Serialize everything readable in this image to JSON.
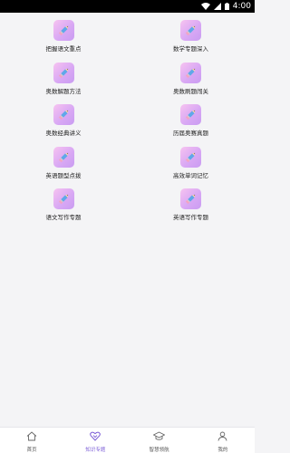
{
  "status_bar": {
    "time": "4:00"
  },
  "topics": [
    {
      "label": "把握语文重点",
      "icon": "pencil-icon"
    },
    {
      "label": "数学专题深入",
      "icon": "pencil-icon"
    },
    {
      "label": "奥数解题方法",
      "icon": "pencil-icon"
    },
    {
      "label": "奥数刷题闯关",
      "icon": "pencil-icon"
    },
    {
      "label": "奥数经典讲义",
      "icon": "pencil-icon"
    },
    {
      "label": "历届奥赛真题",
      "icon": "pencil-icon"
    },
    {
      "label": "英语题型点拨",
      "icon": "pencil-icon"
    },
    {
      "label": "高效单词记忆",
      "icon": "pencil-icon"
    },
    {
      "label": "语文写作专题",
      "icon": "pencil-icon"
    },
    {
      "label": "英语写作专题",
      "icon": "pencil-icon"
    }
  ],
  "bottom_nav": {
    "items": [
      {
        "label": "首页",
        "icon": "home-icon",
        "active": false
      },
      {
        "label": "知识专题",
        "icon": "heart-icon",
        "active": true
      },
      {
        "label": "智慧领航",
        "icon": "graduation-cap-icon",
        "active": false
      },
      {
        "label": "我的",
        "icon": "person-icon",
        "active": false
      }
    ],
    "active_color": "#7b5cd6"
  },
  "colors": {
    "icon_gradient_start": "#f7c3f0",
    "icon_gradient_end": "#c99cf2",
    "background": "#f4f4f6"
  }
}
